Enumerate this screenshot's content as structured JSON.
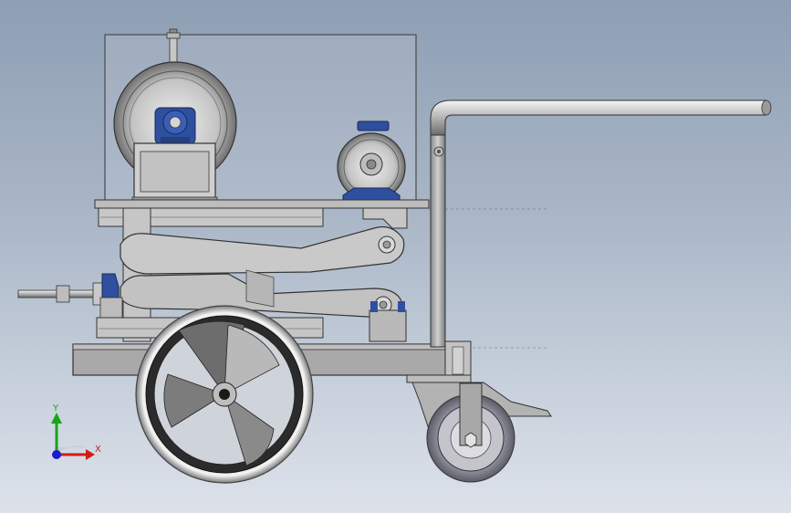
{
  "triad": {
    "x_label": "X",
    "y_label": "Y",
    "x_axis_color": "#d11a1a",
    "y_axis_color": "#1aa31a",
    "z_axis_color": "#1a1ad1"
  },
  "colors": {
    "background_top": "#8e9fb4",
    "background_bottom": "#dde2ea",
    "metal_light": "#c9c9c9",
    "metal_dark": "#5a5a5a",
    "motor_blue": "#2e4b9a",
    "wheel_rim": "#2b2b2b"
  },
  "icons": [
    "coordinate-triad-icon"
  ]
}
